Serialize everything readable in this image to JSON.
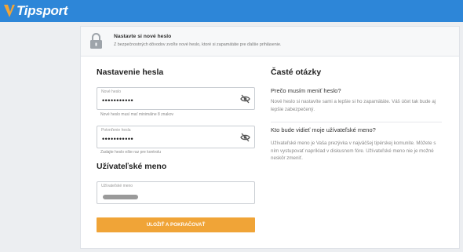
{
  "brand": {
    "name": "Tipsport",
    "accent": "#f0a437",
    "header_bg": "#2d86d8"
  },
  "notice": {
    "title": "Nastavte si nové heslo",
    "text": "Z bezpečnostných dôvodov zvoľte nové heslo, ktoré si zapamätáte pre ďalšie prihlásenie."
  },
  "password_section": {
    "title": "Nastavenie hesla",
    "new_password": {
      "label": "Nové heslo",
      "value": "•••••••••••",
      "hint": "Nové heslo musí mať minimálne 8 znakov",
      "icon": "eye-off-icon"
    },
    "confirm_password": {
      "label": "Potvrďenie hesla",
      "value": "•••••••••••",
      "hint": "Zadajte heslo ešte raz pre kontrolu",
      "icon": "eye-off-icon"
    }
  },
  "username_section": {
    "title": "Užívateľské meno",
    "field": {
      "label": "Užívateľské meno"
    }
  },
  "submit_label": "ULOŽIŤ A POKRAČOVAŤ",
  "faq": {
    "title": "Časté otázky",
    "items": [
      {
        "question": "Prečo musím meniť heslo?",
        "answer": "Nové heslo si nastavíte sami a lepšie si ho zapamätáte. Váš účet tak bude aj lepšie zabezpečený."
      },
      {
        "question": "Kto bude vidieť moje užívateľské meno?",
        "answer": "Užívateľské meno je Vaša prezývka v najväčšej tipérskej komunite. Môžete s ním vystupovať napríklad v diskusnom fóre. Užívateľské meno nie je možné neskôr zmeniť."
      }
    ]
  }
}
